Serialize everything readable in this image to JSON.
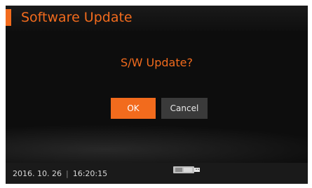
{
  "header": {
    "title": "Software Update"
  },
  "dialog": {
    "message": "S/W Update?",
    "ok_label": "OK",
    "cancel_label": "Cancel"
  },
  "status_bar": {
    "date": "2016. 10. 26",
    "separator": "|",
    "time": "16:20:15",
    "icon": "usb-drive-icon"
  },
  "colors": {
    "accent": "#f26b1d",
    "background": "#0d0d0d",
    "cancel_button": "#3a3a3a",
    "status_bar": "#1a1a1a"
  }
}
